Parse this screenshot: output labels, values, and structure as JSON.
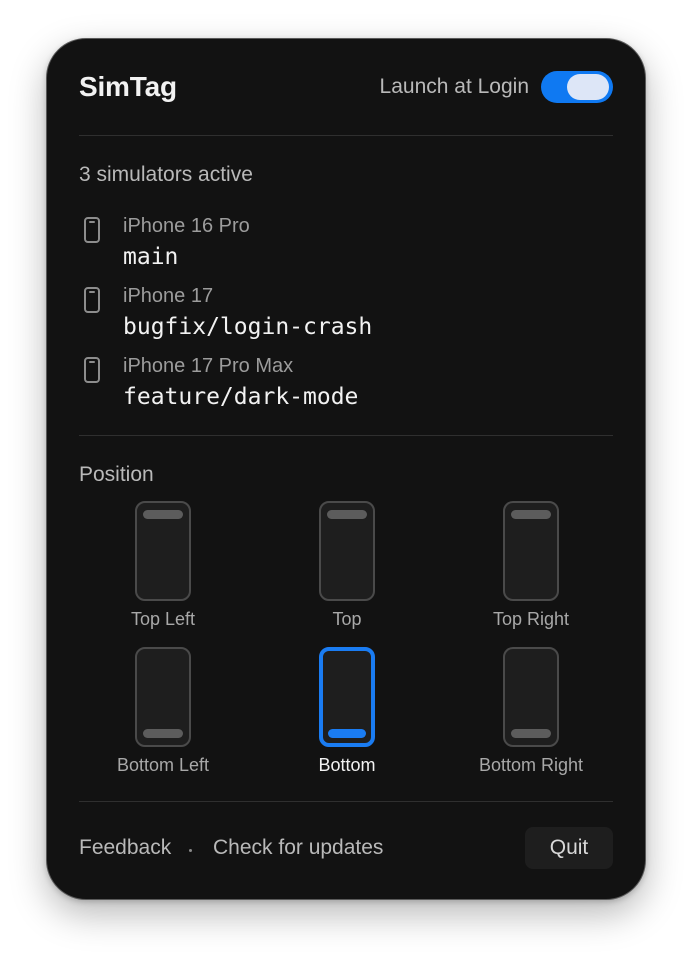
{
  "header": {
    "title": "SimTag",
    "launch_at_login_label": "Launch at Login",
    "launch_at_login_enabled": true
  },
  "simulators": {
    "status": "3 simulators active",
    "items": [
      {
        "icon": "iphone-icon",
        "model": "iPhone 16 Pro",
        "branch": "main"
      },
      {
        "icon": "iphone-icon",
        "model": "iPhone 17",
        "branch": "bugfix/login-crash"
      },
      {
        "icon": "iphone-icon",
        "model": "iPhone 17 Pro Max",
        "branch": "feature/dark-mode"
      }
    ]
  },
  "position": {
    "label": "Position",
    "selected": "Bottom",
    "options": [
      "Top Left",
      "Top",
      "Top Right",
      "Bottom Left",
      "Bottom",
      "Bottom Right"
    ]
  },
  "footer": {
    "feedback": "Feedback",
    "separator": "·",
    "check_updates": "Check for updates",
    "quit": "Quit"
  },
  "colors": {
    "panel_background": "#121212",
    "accent": "#1a7cf2",
    "toggle_on": "#0f79f2"
  }
}
